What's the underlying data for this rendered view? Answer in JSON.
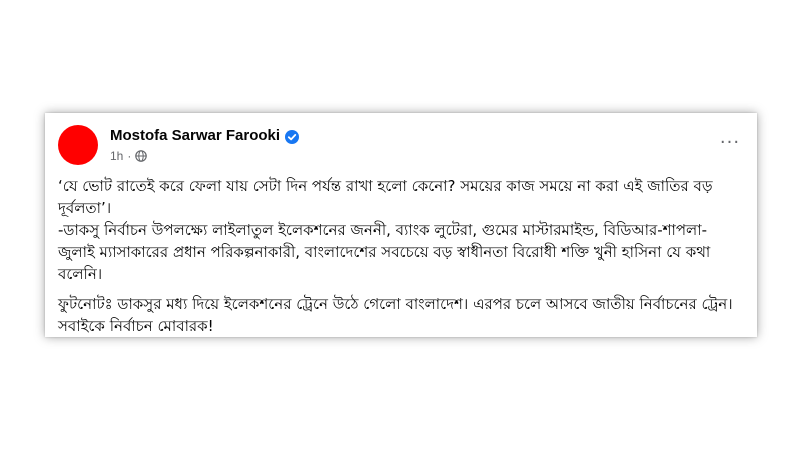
{
  "post": {
    "author": "Mostofa Sarwar Farooki",
    "time": "1h",
    "more_label": "···",
    "paragraphs": [
      "‘যে ভোট রাতেই করে ফেলা যায় সেটা দিন পর্যন্ত রাখা হলো কেনো? সময়ের কাজ সময়ে না করা এই জাতির বড় দূর্বলতা’।\n-ডাকসু নির্বাচন উপলক্ষ্যে লাইলাতুল ইলেকশনের জননী, ব্যাংক লুটেরা, গুমের মাস্টারমাইন্ড, বিডিআর-শাপলা-জুলাই ম্যাসাকারের প্রধান পরিকল্পনাকারী, বাংলাদেশের সবচেয়ে বড় স্বাধীনতা বিরোধী শক্তি খুনী হাসিনা যে কথা বলেনি।",
      "ফুটনোটঃ ডাকসুর মধ্য দিয়ে ইলেকশনের ট্রেনে উঠে গেলো বাংলাদেশ। এরপর চলে আসবে জাতীয় নির্বাচনের ট্রেন। সবাইকে নির্বাচন মোবারক!"
    ]
  },
  "icons": {
    "avatar": "avatar-red-circle",
    "verified": "verified-badge-icon",
    "audience": "globe-icon",
    "more": "more-options-icon"
  },
  "colors": {
    "avatar": "#ff0000",
    "verified": "#1877f2",
    "text": "#050505",
    "meta": "#65676b"
  }
}
